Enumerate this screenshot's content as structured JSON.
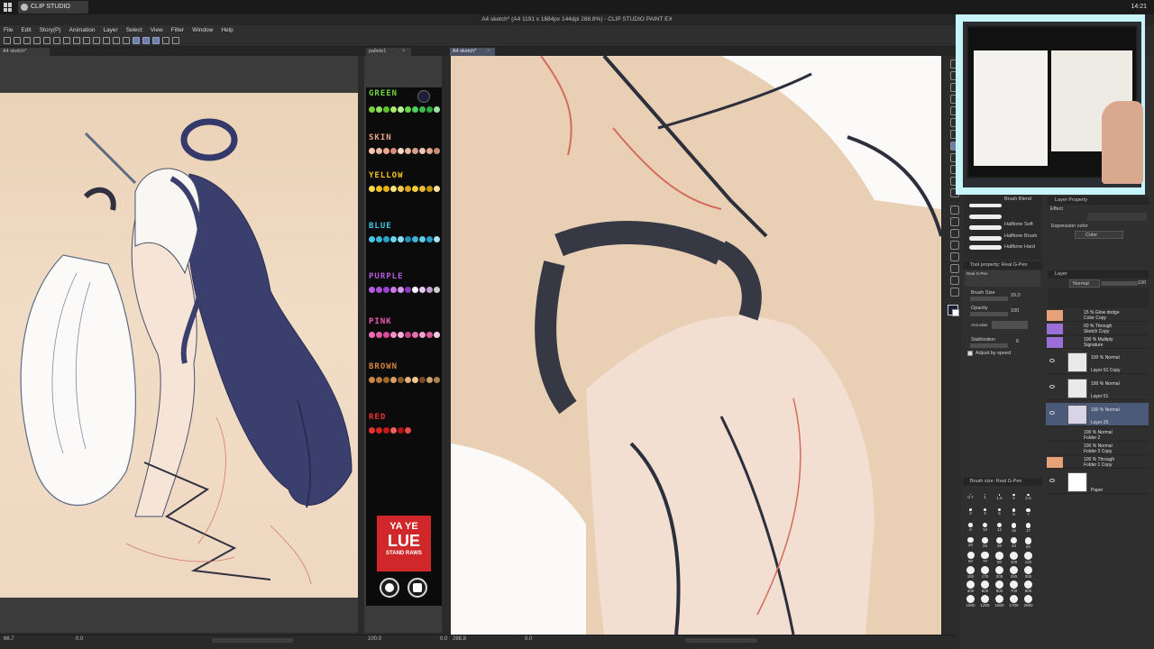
{
  "taskbar": {
    "app_tab": "CLIP STUDIO PAINT",
    "clock": "14:21"
  },
  "window": {
    "title": "A4 sketch* (A4 1191 x 1684px 144dpi 288.8%) - CLIP STUDIO PAINT EX"
  },
  "menu": [
    "File",
    "Edit",
    "Story(P)",
    "Animation",
    "Layer",
    "Select",
    "View",
    "Filter",
    "Window",
    "Help"
  ],
  "tabs": {
    "left": "A4 sketch*",
    "palette": "pallete1",
    "main": "A4 sketch*"
  },
  "palette": {
    "groups": [
      {
        "label": "GREEN",
        "color": "#6fd93b",
        "swatches": [
          "#7ccf3c",
          "#8fe05a",
          "#5fbf2a",
          "#a8e86b",
          "#b7f08a",
          "#6ad44a",
          "#4fcf5e",
          "#3fb84b",
          "#2fa840",
          "#9be3a0"
        ]
      },
      {
        "label": "SKIN",
        "color": "#f0a58a",
        "swatches": [
          "#f4c7b2",
          "#f0b9a0",
          "#e7a98e",
          "#d98c74",
          "#f7d7c8",
          "#e8b8a2",
          "#d9a08a",
          "#f1c5b6",
          "#e1a68f",
          "#c98a72"
        ]
      },
      {
        "label": "YELLOW",
        "color": "#f2c21c",
        "swatches": [
          "#f7d54a",
          "#f2c21c",
          "#e6b010",
          "#f8df7a",
          "#f0c850",
          "#d9a412",
          "#f4cc36",
          "#e8bb2c",
          "#c7920c",
          "#fae49a"
        ]
      },
      {
        "label": "BLUE",
        "color": "#41c6e8",
        "swatches": [
          "#48c7e8",
          "#3ab5d9",
          "#2aa2c8",
          "#69d4ef",
          "#87def2",
          "#1f8fb9",
          "#3fb0d4",
          "#5cc9e6",
          "#2b9bc4",
          "#a4e6f6"
        ]
      },
      {
        "label": "PURPLE",
        "color": "#b25ae0",
        "swatches": [
          "#b65ee2",
          "#a84fd8",
          "#9b43cc",
          "#c97ae8",
          "#d89aef",
          "#8b38bd",
          "#ffffff",
          "#e6c4f4",
          "#bda0d0",
          "#cfcfcf"
        ]
      },
      {
        "label": "PINK",
        "color": "#f05ab4",
        "swatches": [
          "#f26bb8",
          "#e858a8",
          "#d84a98",
          "#f490c8",
          "#f7b0d6",
          "#c8408a",
          "#e070b0",
          "#f4a0ca",
          "#d65c9e",
          "#fac8e2"
        ]
      },
      {
        "label": "BROWN",
        "color": "#d9833e",
        "swatches": [
          "#c98a4a",
          "#b57838",
          "#a06628",
          "#d9a06a",
          "#8a5a2a",
          "#e0b47c",
          "#f0c890",
          "#7a4a22",
          "#c9a070",
          "#a88450"
        ]
      },
      {
        "label": "RED",
        "color": "#e8322f",
        "swatches": [
          "#e8322f",
          "#d62420",
          "#c41a18",
          "#f0605c",
          "#b01412",
          "#e84a46"
        ]
      }
    ],
    "badge": {
      "line1": "YA YE",
      "line2": "LUE",
      "line3": "STAND RAWS"
    }
  },
  "status": {
    "left_zoom": "66.7",
    "left_val": "0.0",
    "mid_zoom": "100.0",
    "mid_val": "0.0",
    "main_zoom": "288.8",
    "main_val": "0.0"
  },
  "brush_panel": {
    "items": [
      "Brush Blend",
      "Halftone Soft",
      "Halftone Brush",
      "Halftone Hard"
    ],
    "tool_property_title": "Tool property: Real G-Pen",
    "tool_name": "Real G-Pen",
    "brush_size_label": "Brush Size",
    "brush_size_value": "20.0",
    "opacity_label": "Opacity",
    "opacity_value": "100",
    "antialias_label": "Anti-alias",
    "stabilization_label": "Stabilization",
    "stabilization_value": "6",
    "adjust_label": "Adjust by speed",
    "brush_size_panel_title": "Brush size: Real G-Pen",
    "sizes": [
      "0.7",
      "1",
      "1.5",
      "2",
      "2.5",
      "3",
      "4",
      "5",
      "6",
      "7",
      "8",
      "10",
      "12",
      "15",
      "17",
      "20",
      "25",
      "30",
      "40",
      "50",
      "60",
      "70",
      "80",
      "100",
      "120",
      "150",
      "170",
      "200",
      "250",
      "300",
      "400",
      "500",
      "600",
      "700",
      "800",
      "1000",
      "1200",
      "1500",
      "1700",
      "2000"
    ]
  },
  "layer_property": {
    "title": "Layer Property",
    "effect": "Effect",
    "expression_label": "Expression color",
    "expression_value": "Color"
  },
  "layers_panel": {
    "title": "Layer",
    "blend": "Normal",
    "opacity": "100",
    "layers": [
      {
        "line1": "15 % Glow dodge",
        "line2": "Color Copy"
      },
      {
        "line1": "60 % Through",
        "line2": "Sketch Copy"
      },
      {
        "line1": "100 % Multiply",
        "line2": "Signature"
      },
      {
        "line1": "100 % Normal",
        "line2": "Layer 51 Copy"
      },
      {
        "line1": "100 % Normal",
        "line2": "Layer 51"
      },
      {
        "line1": "100 % Normal",
        "line2": "Layer 25"
      },
      {
        "line1": "100 % Normal",
        "line2": "Folder 2"
      },
      {
        "line1": "100 % Normal",
        "line2": "Folder 3 Copy"
      },
      {
        "line1": "100 % Through",
        "line2": "Folder 1 Copy"
      },
      {
        "line1": "",
        "line2": "Paper"
      }
    ]
  }
}
